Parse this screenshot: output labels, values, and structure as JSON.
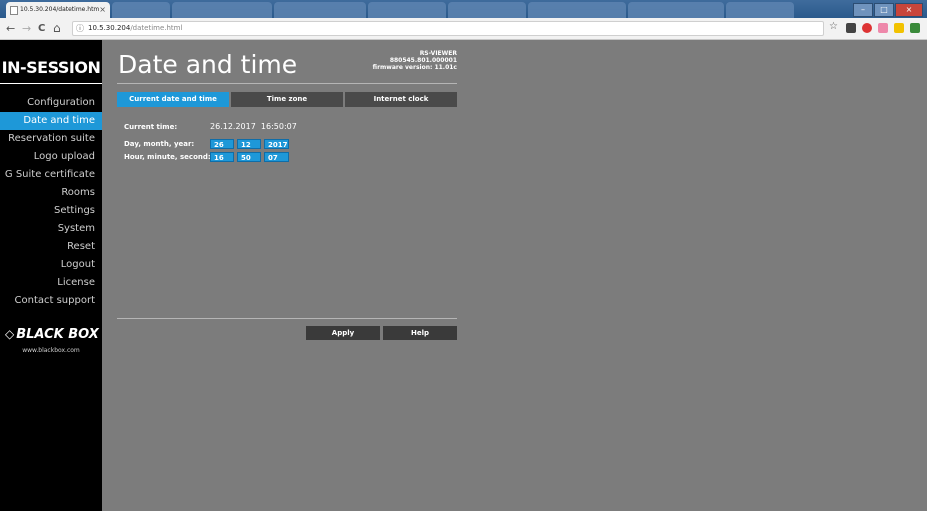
{
  "browser": {
    "active_tab_title": "10.5.30.204/datetime.htm",
    "tab_close": "×",
    "url_host": "10.5.30.204",
    "url_path": "/datetime.html",
    "nav_back": "←",
    "nav_forward": "→",
    "nav_reload": "C",
    "nav_home": "⌂",
    "info_icon": "ⓘ",
    "star_icon": "☆",
    "win_min": "–",
    "win_max": "□",
    "win_close": "×"
  },
  "sidebar": {
    "brand": "IN-SESSION",
    "items": [
      {
        "label": "Configuration"
      },
      {
        "label": "Date and time"
      },
      {
        "label": "Reservation suite"
      },
      {
        "label": "Logo upload"
      },
      {
        "label": "G Suite certificate"
      },
      {
        "label": "Rooms"
      },
      {
        "label": "Settings"
      },
      {
        "label": "System"
      },
      {
        "label": "Reset"
      },
      {
        "label": "Logout"
      },
      {
        "label": "License"
      },
      {
        "label": "Contact support"
      }
    ],
    "active_index": 1,
    "logo_text": "BLACK BOX",
    "logo_mark": "◇",
    "logo_url": "www.blackbox.com"
  },
  "header": {
    "title": "Date and time",
    "device_model": "RS-VIEWER",
    "device_serial": "880545.801.000001",
    "firmware": "firmware version: 11.01c"
  },
  "tabs": [
    {
      "label": "Current date and time",
      "active": true
    },
    {
      "label": "Time zone",
      "active": false
    },
    {
      "label": "Internet clock",
      "active": false
    }
  ],
  "form": {
    "current_time_label": "Current time:",
    "current_time_value": "26.12.2017  16:50:07",
    "date_label": "Day, month, year:",
    "day": "26",
    "month": "12",
    "year": "2017",
    "time_label": "Hour, minute, second:",
    "hour": "16",
    "minute": "50",
    "second": "07"
  },
  "buttons": {
    "apply": "Apply",
    "help": "Help"
  },
  "colors": {
    "accent": "#1e98d8",
    "background": "#7c7c7c",
    "sidebar": "#000000"
  }
}
